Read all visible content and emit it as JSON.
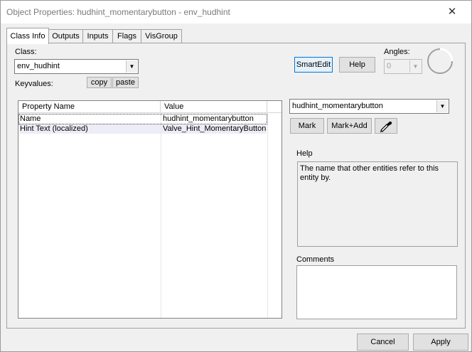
{
  "window": {
    "title": "Object Properties: hudhint_momentarybutton - env_hudhint"
  },
  "tabs": [
    {
      "label": "Class Info",
      "active": true
    },
    {
      "label": "Outputs"
    },
    {
      "label": "Inputs"
    },
    {
      "label": "Flags"
    },
    {
      "label": "VisGroup"
    }
  ],
  "class_info": {
    "class_label": "Class:",
    "class_value": "env_hudhint",
    "keyvalues_label": "Keyvalues:",
    "copy_label": "copy",
    "paste_label": "paste",
    "smartedit_label": "SmartEdit",
    "help_button_label": "Help",
    "angles_label": "Angles:",
    "angles_value": "0"
  },
  "table": {
    "columns": [
      "Property Name",
      "Value"
    ],
    "rows": [
      {
        "name": "Name",
        "value": "hudhint_momentarybutton",
        "selected": true
      },
      {
        "name": "Hint Text (localized)",
        "value": "Valve_Hint_MomentaryButton"
      }
    ]
  },
  "right_panel": {
    "value_combo": "hudhint_momentarybutton",
    "mark_label": "Mark",
    "mark_add_label": "Mark+Add",
    "help_title": "Help",
    "help_text": "The name that other entities refer to this entity by.",
    "comments_title": "Comments",
    "comments_text": ""
  },
  "footer": {
    "cancel_label": "Cancel",
    "apply_label": "Apply"
  }
}
